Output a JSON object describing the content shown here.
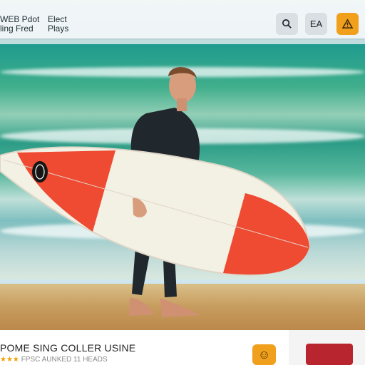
{
  "header": {
    "logo_line1": "WEB Pdot",
    "logo_line2": "ling Fred",
    "nav_line1": "Elect",
    "nav_line2": "Plays",
    "language_label": "EA"
  },
  "promo": {
    "title": "POME SING COLLER USINE",
    "stars": "★★★",
    "subtitle": "FPSC AUNKED 11 HEADS"
  },
  "colors": {
    "accent_orange": "#f0a01c",
    "header_bg": "#f2f6f7",
    "thumb_red": "#b9252f",
    "board_red": "#ef4a32",
    "wetsuit": "#20272d"
  },
  "icons": {
    "search": "search-icon",
    "warning": "warning-icon",
    "badge": "face-icon"
  }
}
